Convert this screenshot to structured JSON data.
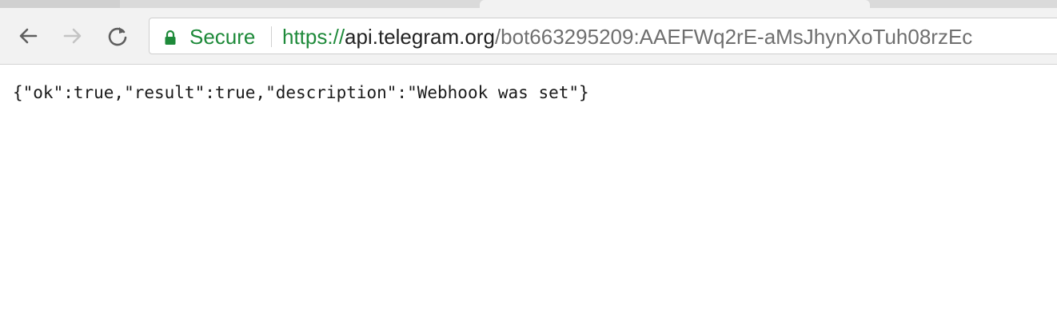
{
  "browser": {
    "address_bar": {
      "security_label": "Secure",
      "url_scheme": "https://",
      "url_host": "api.telegram.org",
      "url_path": "/bot663295209:AAEFWq2rE-aMsJhynXoTuh08rzEc"
    }
  },
  "page": {
    "body_text": "{\"ok\":true,\"result\":true,\"description\":\"Webhook was set\"}"
  },
  "icons": {
    "back": "back-arrow-icon",
    "forward": "forward-arrow-icon",
    "reload": "reload-icon",
    "lock": "lock-icon"
  },
  "colors": {
    "secure_green": "#1e8a3a",
    "toolbar_bg": "#f2f2f2"
  }
}
